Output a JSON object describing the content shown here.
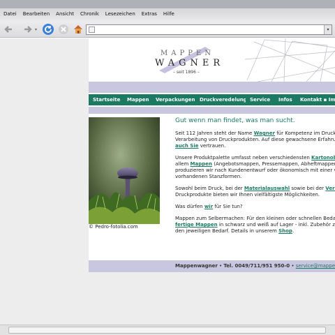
{
  "menu": [
    "Datei",
    "Bearbeiten",
    "Ansicht",
    "Chronik",
    "Lesezeichen",
    "Extras",
    "Hilfe"
  ],
  "toolbar": {
    "back": "back-icon",
    "forward": "forward-icon",
    "reload": "reload-icon",
    "stop": "stop-icon",
    "home": "home-icon"
  },
  "address": {
    "value": ""
  },
  "logo": {
    "line1": "MAPPEN",
    "line2": "WAGNER",
    "line3": "– seit 1896 –"
  },
  "nav": [
    "Startseite",
    "Mappen",
    "Verpackungen",
    "Druckveredelung",
    "Service",
    "Infos",
    "Kontakt",
    "Imp"
  ],
  "caption": "© Pedro-fotolia.com",
  "headline": "Gut wenn man findet, was man sucht.",
  "paragraphs": [
    {
      "a": "Seit 112 Jahren steht der Name ",
      "l": "Wagner",
      "b": " für Kompetenz im Druck und in"
    },
    {
      "a": "Verarbeitung von Druckprodukten. Auf diese gewachsene Erfahrung kö",
      "l": "",
      "b": ""
    },
    {
      "a": "",
      "l": "auch Sie",
      "b": " vertrauen."
    }
  ],
  "p2": [
    "Unsere Produktpalette umfasst neben verschiedensten ",
    "Kartonobjekte",
    "allem ",
    "Mappen",
    " (Angebotsmappen, Pressemappen, Abheftmappen). Dies",
    "produzieren wir nach Kundenentwurf oder ökonomisch mit einer von üb",
    "vorhandenen Stanzformen."
  ],
  "p3": [
    "Sowohl beim Druck, bei der ",
    "Materialauswahl",
    " sowie bei der ",
    "Veredelun",
    "Druckprodukte bieten wir Ihnen vielfältigste Möglichkeiten."
  ],
  "p4": [
    "Was dürfen ",
    "wir",
    " für Sie tun?"
  ],
  "p5": [
    "Mappen zum Selbermachen: Für den kleinen oder schnellen Bedarf hab",
    "fertige Mappen",
    " in schwarz und weiß auf Lager - inkl. Zubehör zum Anp",
    "den jeweiligen Bedarf. Details in unserem ",
    "Shop",
    "."
  ],
  "footer": {
    "name": "Mappenwagner",
    "sep": " • ",
    "tel": "Tel. 0049/711/951 950-0",
    "sep2": " • ",
    "mail": "service@mappenwag"
  },
  "colors": {
    "accent": "#1d7a62",
    "band": "#c9c6df"
  }
}
